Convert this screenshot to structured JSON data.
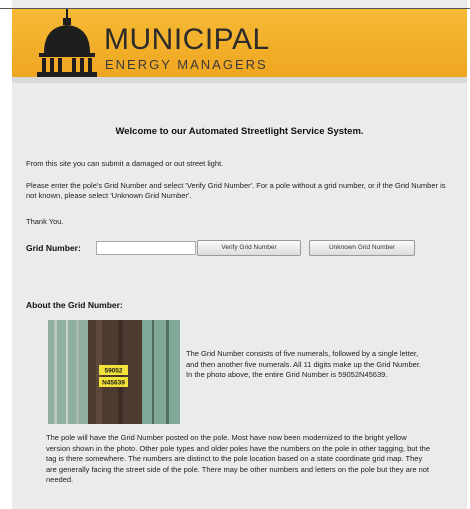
{
  "brand": {
    "name": "MUNICIPAL",
    "tagline": "ENERGY MANAGERS"
  },
  "main": {
    "welcome": "Welcome to our Automated Streetlight Service System.",
    "intro": "From this site you can submit a damaged or out street light.",
    "instructions": "Please enter the pole's Grid Number and select 'Verify Grid Number'. For a pole without a grid number, or if the Grid Number is not known, please select 'Unknown Grid Number'.",
    "thanks": "Thank You.",
    "grid_label": "Grid Number:",
    "grid_value": "",
    "verify_label": "Verify Grid Number",
    "unknown_label": "Unknown Grid Number"
  },
  "about": {
    "heading": "About the Grid Number:",
    "tag_top": "59052",
    "tag_bottom": "N45639",
    "description": "The Grid Number consists of five numerals, followed by a single letter, and then another five numerals.  All 11 digits make up the Grid Number. In the photo above, the entire Grid Number is 59052N45639.",
    "details": "The pole will have the Grid Number posted on the pole. Most have now been modernized to the bright yellow version shown in the photo. Other pole types and older poles have the numbers on the pole in other tagging, but the tag is there somewhere. The numbers are distinct to the pole location based on a state coordinate grid map. They are generally facing the street side of the pole. There may be other numbers and letters on the pole but they are not needed."
  },
  "colors": {
    "header": "#f2ae2a",
    "background": "#ebebeb",
    "tag": "#f2e23a"
  }
}
